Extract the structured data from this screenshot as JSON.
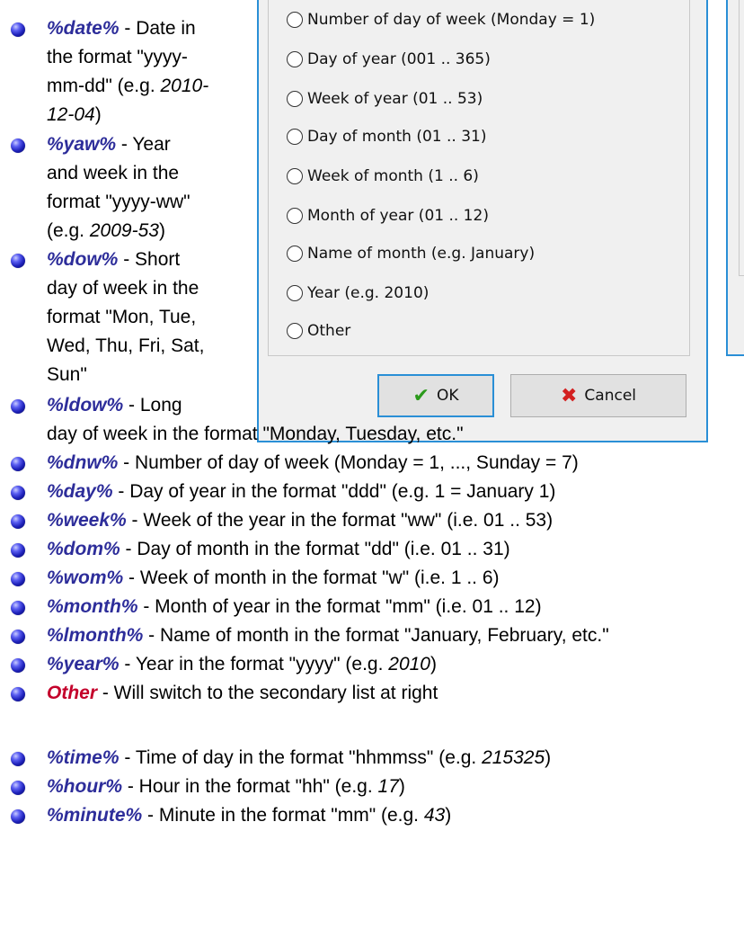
{
  "dialog": {
    "radio_options": [
      "Number of day of week (Monday = 1)",
      "Day of year (001 .. 365)",
      "Week of year (01 .. 53)",
      "Day of month (01 .. 31)",
      "Week of month (1 .. 6)",
      "Month of year (01 .. 12)",
      "Name of month (e.g. January)",
      "Year (e.g. 2010)",
      "Other"
    ],
    "ok_label": "OK",
    "cancel_label": "Cancel",
    "ok_glyph": "✔",
    "cancel_glyph": "✖"
  },
  "narrow_items": [
    {
      "code": "%date%",
      "lines": [
        "- Date in",
        "the format \"yyyy-",
        "mm-dd\" (e.g. 2010-",
        "12-04)"
      ]
    },
    {
      "code": "%yaw%",
      "lines": [
        "- Year",
        "and week in the",
        "format \"yyyy-ww\"",
        "(e.g. 2009-53)"
      ]
    },
    {
      "code": "%dow%",
      "lines": [
        "- Short",
        "day of week in the",
        "format \"Mon, Tue,",
        "Wed, Thu, Fri, Sat,",
        "Sun\""
      ]
    },
    {
      "code": "%ldow%",
      "lines": [
        "- Long",
        "day of week in the format \"Monday, Tuesday, etc.\""
      ]
    }
  ],
  "items": [
    {
      "code": "%dnw%",
      "text": " - Number of day of week (Monday = 1, ..., Sunday = 7)"
    },
    {
      "code": "%day%",
      "text": " - Day of year in the format \"ddd\" (e.g. 1 = January 1)"
    },
    {
      "code": "%week%",
      "text": " - Week of the year in the format \"ww\" (i.e. 01 .. 53)"
    },
    {
      "code": "%dom%",
      "text": " - Day of month in the format \"dd\" (i.e. 01 .. 31)"
    },
    {
      "code": "%wom%",
      "text": " - Week of month in the format \"w\" (i.e. 1 .. 6)"
    },
    {
      "code": "%month%",
      "text": " - Month of year in the format \"mm\" (i.e. 01 .. 12)"
    },
    {
      "code": "%lmonth%",
      "text": " - Name of month in the format \"January, February, etc.\""
    },
    {
      "code": "%year%",
      "text": " - Year in the format \"yyyy\" (e.g. ",
      "example": "2010",
      "tail": ")"
    },
    {
      "code": "Other",
      "text": " - Will switch to the secondary list at right",
      "other": true
    }
  ],
  "items2": [
    {
      "code": "%time%",
      "text": " - Time of day in the format \"hhmmss\" (e.g. ",
      "example": "215325",
      "tail": ")"
    },
    {
      "code": "%hour%",
      "text": " - Hour in the format \"hh\" (e.g. ",
      "example": "17",
      "tail": ")"
    },
    {
      "code": "%minute%",
      "text": " - Minute in the format \"mm\" (e.g. ",
      "example": "43",
      "tail": ")"
    }
  ]
}
